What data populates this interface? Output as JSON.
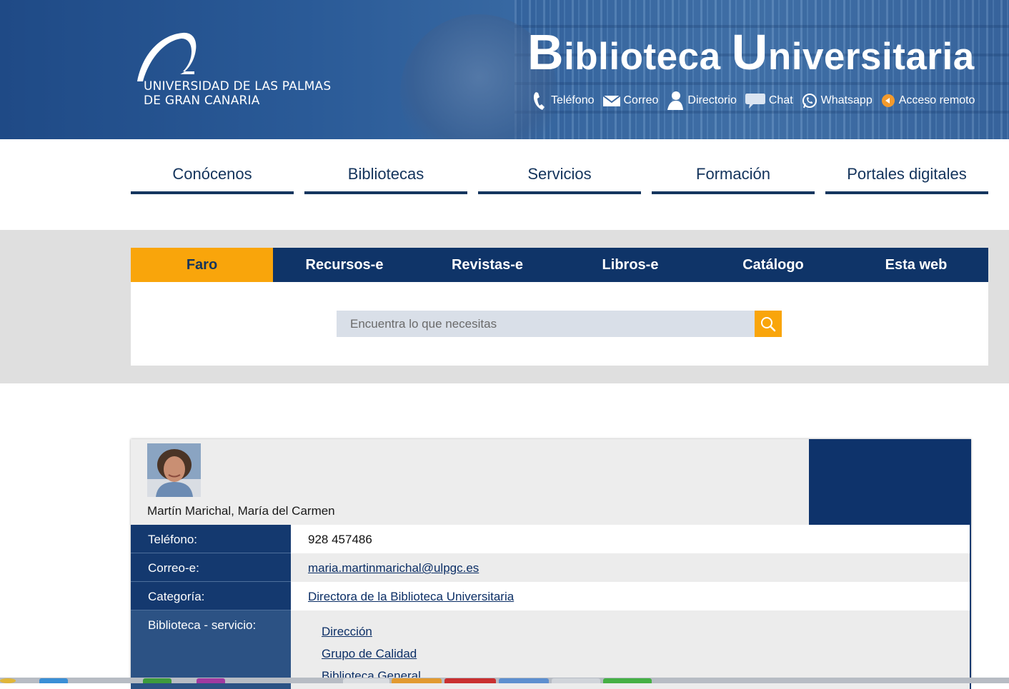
{
  "header": {
    "logo_line1": "UNIVERSIDAD DE LAS PALMAS",
    "logo_line2": "DE GRAN CANARIA",
    "title_initial1": "B",
    "title_rest1": "iblioteca ",
    "title_initial2": "U",
    "title_rest2": "niversitaria",
    "contacts": [
      {
        "label": "Teléfono",
        "icon": "phone-icon"
      },
      {
        "label": "Correo",
        "icon": "mail-icon"
      },
      {
        "label": "Directorio",
        "icon": "person-icon"
      },
      {
        "label": "Chat",
        "icon": "chat-bubble-icon"
      },
      {
        "label": "Whatsapp",
        "icon": "whatsapp-icon"
      },
      {
        "label": "Acceso remoto",
        "icon": "remote-access-icon"
      }
    ]
  },
  "nav": {
    "items": [
      {
        "label": "Conócenos"
      },
      {
        "label": "Bibliotecas"
      },
      {
        "label": "Servicios"
      },
      {
        "label": "Formación"
      },
      {
        "label": "Portales digitales"
      }
    ]
  },
  "search": {
    "tabs": [
      {
        "label": "Faro",
        "active": true
      },
      {
        "label": "Recursos-e"
      },
      {
        "label": "Revistas-e"
      },
      {
        "label": "Libros-e"
      },
      {
        "label": "Catálogo"
      },
      {
        "label": "Esta web"
      }
    ],
    "placeholder": "Encuentra lo que necesitas",
    "button_icon": "search-icon"
  },
  "person": {
    "name": "Martín Marichal, María del Carmen",
    "rows": [
      {
        "label": "Teléfono:",
        "value": "928 457486"
      },
      {
        "label": "Correo-e:",
        "value": "maria.martinmarichal@ulpgc.es"
      },
      {
        "label": "Categoría:",
        "value": "Directora de la Biblioteca Universitaria"
      }
    ],
    "service_label": "Biblioteca - servicio:",
    "services": [
      "Dirección",
      "Grupo de Calidad",
      "Biblioteca General"
    ]
  },
  "colors": {
    "brand_dark": "#0f3468",
    "accent": "#f9a50b",
    "search_bg": "#dfdfdf"
  }
}
